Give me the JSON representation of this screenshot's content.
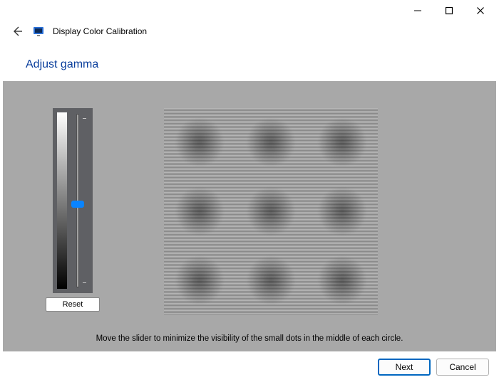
{
  "window": {
    "title": "Display Color Calibration"
  },
  "heading": "Adjust gamma",
  "slider": {
    "value": 50,
    "min": 0,
    "max": 100
  },
  "buttons": {
    "reset": "Reset",
    "next": "Next",
    "cancel": "Cancel"
  },
  "instruction": "Move the slider to minimize the visibility of the small dots in the middle of each circle."
}
